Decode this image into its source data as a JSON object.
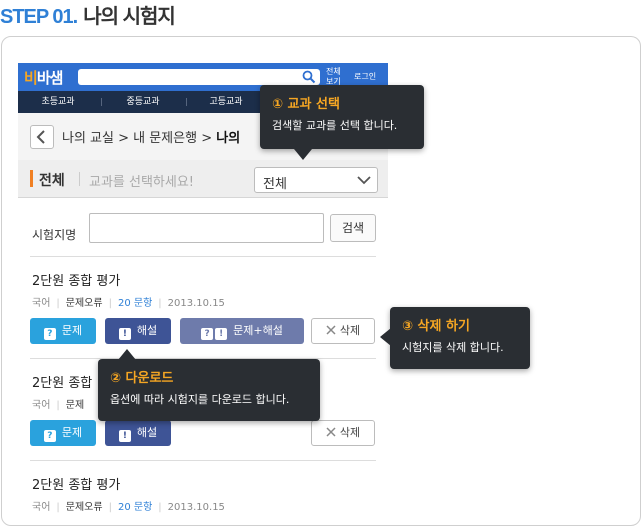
{
  "page": {
    "step": "STEP 01.",
    "label": "나의 시험지"
  },
  "app": {
    "logo_prefix": "비",
    "logo_suffix": "바샘",
    "link_all_line1": "전체",
    "link_all_line2": "보기",
    "link_login": "로그인"
  },
  "nav": {
    "items": [
      "초등교과",
      "중등교과",
      "고등교과"
    ]
  },
  "breadcrumb": {
    "path": "나의 교실 > 내 문제은행 > ",
    "current": "나의"
  },
  "filter": {
    "title": "전체",
    "hint": "교과를 선택하세요!",
    "selected": "전체"
  },
  "search": {
    "label": "시험지명",
    "value": "",
    "button": "검색"
  },
  "items": [
    {
      "title": "2단원 종합 평가",
      "subject": "국어",
      "type": "문제오류",
      "count": "20 문항",
      "date": "2013.10.15"
    },
    {
      "title": "2단원 종합",
      "subject": "국어",
      "type": "문제",
      "count": "",
      "date": ""
    },
    {
      "title": "2단원 종합 평가",
      "subject": "국어",
      "type": "문제오류",
      "count": "20 문항",
      "date": "2013.10.15"
    }
  ],
  "buttons": {
    "question": "문제",
    "answer": "해설",
    "question_answer": "문제+해설",
    "delete": "삭제",
    "q_badge": "?",
    "a_badge": "!"
  },
  "tooltips": {
    "subject": {
      "title": "① 교과 선택",
      "desc": "검색할 교과를 선택 합니다."
    },
    "delete": {
      "title": "③ 삭제 하기",
      "desc": "시험지를 삭제 합니다."
    },
    "download": {
      "title": "② 다운로드",
      "desc": "옵션에 따라 시험지를 다운로드 합니다."
    }
  },
  "colors": {
    "accent": "#2f80d6",
    "topbar": "#2f6fd0",
    "nav": "#1c2e4a",
    "question_button": "#2aa2dd",
    "answer_button": "#3e5496",
    "tooltip_bg": "#2a2e33",
    "tooltip_title": "#f5a623"
  }
}
